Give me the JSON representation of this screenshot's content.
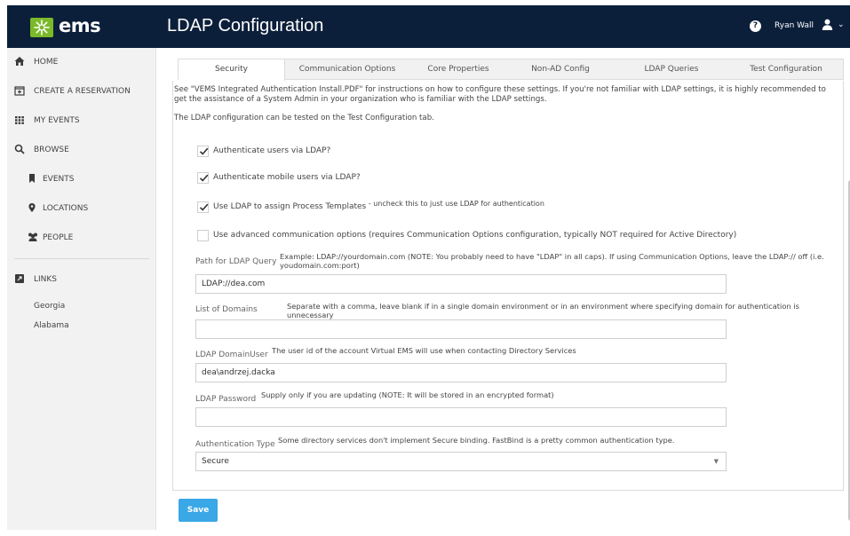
{
  "app": {
    "logo_text": "ems",
    "page_title": "LDAP Configuration",
    "help_icon_text": "?",
    "user_name": "Ryan Wall"
  },
  "sidebar": {
    "items": [
      {
        "label": "HOME",
        "icon": "home-icon"
      },
      {
        "label": "CREATE A RESERVATION",
        "icon": "calendar-plus-icon"
      },
      {
        "label": "MY EVENTS",
        "icon": "grid-icon"
      },
      {
        "label": "BROWSE",
        "icon": "search-icon"
      },
      {
        "label": "EVENTS",
        "icon": "bookmark-icon"
      },
      {
        "label": "LOCATIONS",
        "icon": "map-pin-icon"
      },
      {
        "label": "PEOPLE",
        "icon": "people-icon"
      }
    ],
    "links_header": "LINKS",
    "links": [
      "Georgia",
      "Alabama"
    ]
  },
  "tabs": [
    "Security",
    "Communication Options",
    "Core Properties",
    "Non-AD Config",
    "LDAP Queries",
    "Test Configuration"
  ],
  "active_tab": "Security",
  "intro": {
    "line1": "See \"VEMS Integrated Authentication Install.PDF\" for instructions on how to configure these settings. If you're not familiar with LDAP settings, it is highly recommended to get the assistance of a System Admin in your organization who is familiar with the LDAP settings.",
    "line2": "The LDAP configuration can be tested on the Test Configuration tab."
  },
  "checkboxes": [
    {
      "label": "Authenticate users via LDAP?",
      "checked": true,
      "note": ""
    },
    {
      "label": "Authenticate mobile users via LDAP?",
      "checked": true,
      "note": ""
    },
    {
      "label": "Use LDAP to assign Process Templates",
      "checked": true,
      "note": " - uncheck this to just use LDAP for authentication"
    },
    {
      "label": "Use advanced communication options (requires Communication Options configuration, typically NOT required for Active Directory)",
      "checked": false,
      "note": ""
    }
  ],
  "fields": {
    "ldap_path": {
      "label": "Path for LDAP Query",
      "help": "Example: LDAP://yourdomain.com (NOTE: You probably need to have \"LDAP\" in all caps). If using Communication Options, leave the LDAP:// off (i.e. youdomain.com:port)",
      "value": "LDAP://dea.com"
    },
    "domains": {
      "label": "List of Domains",
      "help": "Separate with a comma, leave blank if in a single domain environment or in an environment where specifying domain for authentication is unnecessary",
      "value": ""
    },
    "domain_user": {
      "label": "LDAP DomainUser",
      "help": "The user id of the account Virtual EMS will use when contacting Directory Services",
      "value": "dea\\andrzej.dacka"
    },
    "password": {
      "label": "LDAP Password",
      "help": "Supply only if you are updating (NOTE: It will be stored in an encrypted format)",
      "value": ""
    },
    "auth_type": {
      "label": "Authentication Type",
      "help": "Some directory services don't implement Secure binding. FastBind is a pretty common authentication type.",
      "value": "Secure"
    }
  },
  "save_label": "Save",
  "colors": {
    "header_bg": "#0c1f3a",
    "logo_green": "#7ab929",
    "save_button": "#3aa7e6"
  }
}
